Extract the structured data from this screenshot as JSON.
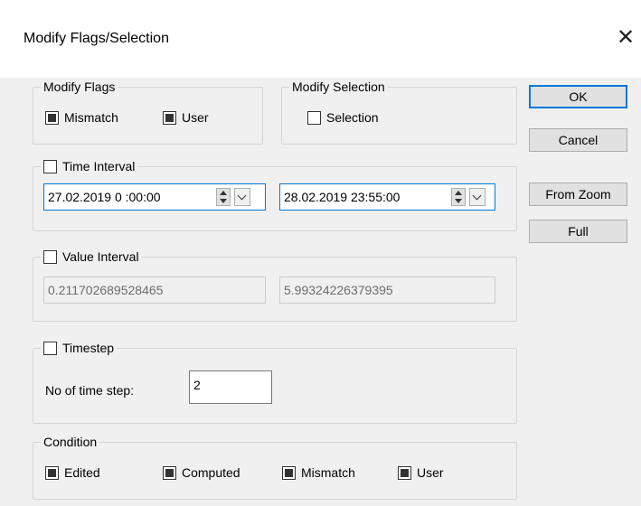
{
  "window": {
    "title": "Modify Flags/Selection",
    "close_glyph": "✕"
  },
  "modify_flags": {
    "legend": "Modify Flags",
    "mismatch": {
      "label": "Mismatch",
      "checked": true
    },
    "user": {
      "label": "User",
      "checked": true
    }
  },
  "modify_selection": {
    "legend": "Modify Selection",
    "selection": {
      "label": "Selection",
      "checked": false
    }
  },
  "time_interval": {
    "label": "Time Interval",
    "checked": false,
    "start": "27.02.2019  0 :00:00",
    "end": "28.02.2019 23:55:00"
  },
  "value_interval": {
    "label": "Value Interval",
    "checked": false,
    "min": "0.211702689528465",
    "max": "5.99324226379395"
  },
  "timestep": {
    "label": "Timestep",
    "checked": false,
    "steps_label": "No of time step:",
    "steps_value": "2"
  },
  "condition": {
    "legend": "Condition",
    "edited": {
      "label": "Edited",
      "checked": true
    },
    "computed": {
      "label": "Computed",
      "checked": true
    },
    "mismatch": {
      "label": "Mismatch",
      "checked": true
    },
    "user": {
      "label": "User",
      "checked": true
    }
  },
  "buttons": {
    "ok": "OK",
    "cancel": "Cancel",
    "from_zoom": "From Zoom",
    "full": "Full"
  }
}
